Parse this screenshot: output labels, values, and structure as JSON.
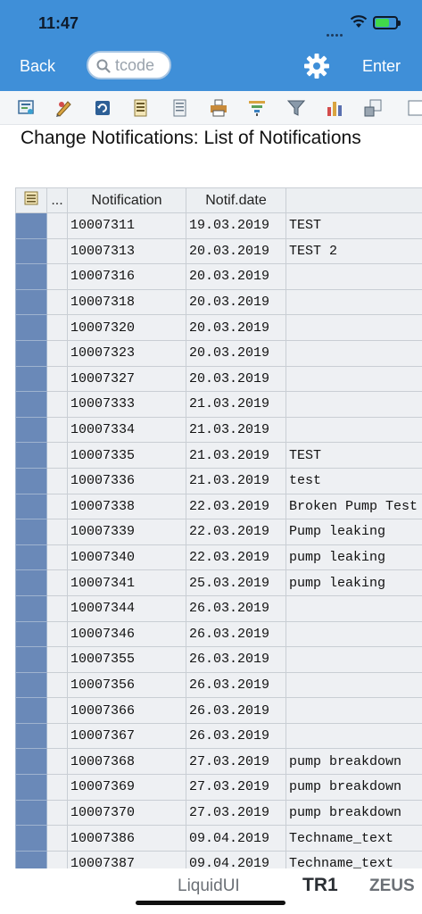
{
  "status": {
    "time": "11:47"
  },
  "nav": {
    "back_label": "Back",
    "search_placeholder": "tcode",
    "enter_label": "Enter"
  },
  "toolbar": {
    "icons": [
      "detail-icon",
      "edit-icon",
      "refresh-icon",
      "select-layout-icon",
      "change-layout-icon",
      "print-icon",
      "sort-icon",
      "filter-icon",
      "chart-icon",
      "export-icon",
      "more-icon"
    ]
  },
  "page": {
    "title": "Change Notifications: List of Notifications"
  },
  "table": {
    "headers": {
      "more": "...",
      "notification": "Notification",
      "date": "Notif.date"
    },
    "rows": [
      {
        "notification": "10007311",
        "date": "19.03.2019",
        "desc": "TEST"
      },
      {
        "notification": "10007313",
        "date": "20.03.2019",
        "desc": "TEST 2"
      },
      {
        "notification": "10007316",
        "date": "20.03.2019",
        "desc": ""
      },
      {
        "notification": "10007318",
        "date": "20.03.2019",
        "desc": ""
      },
      {
        "notification": "10007320",
        "date": "20.03.2019",
        "desc": ""
      },
      {
        "notification": "10007323",
        "date": "20.03.2019",
        "desc": ""
      },
      {
        "notification": "10007327",
        "date": "20.03.2019",
        "desc": ""
      },
      {
        "notification": "10007333",
        "date": "21.03.2019",
        "desc": ""
      },
      {
        "notification": "10007334",
        "date": "21.03.2019",
        "desc": ""
      },
      {
        "notification": "10007335",
        "date": "21.03.2019",
        "desc": "TEST"
      },
      {
        "notification": "10007336",
        "date": "21.03.2019",
        "desc": "test"
      },
      {
        "notification": "10007338",
        "date": "22.03.2019",
        "desc": "Broken Pump Test"
      },
      {
        "notification": "10007339",
        "date": "22.03.2019",
        "desc": "Pump leaking"
      },
      {
        "notification": "10007340",
        "date": "22.03.2019",
        "desc": "pump leaking"
      },
      {
        "notification": "10007341",
        "date": "25.03.2019",
        "desc": "pump leaking"
      },
      {
        "notification": "10007344",
        "date": "26.03.2019",
        "desc": ""
      },
      {
        "notification": "10007346",
        "date": "26.03.2019",
        "desc": ""
      },
      {
        "notification": "10007355",
        "date": "26.03.2019",
        "desc": ""
      },
      {
        "notification": "10007356",
        "date": "26.03.2019",
        "desc": ""
      },
      {
        "notification": "10007366",
        "date": "26.03.2019",
        "desc": ""
      },
      {
        "notification": "10007367",
        "date": "26.03.2019",
        "desc": ""
      },
      {
        "notification": "10007368",
        "date": "27.03.2019",
        "desc": "pump breakdown"
      },
      {
        "notification": "10007369",
        "date": "27.03.2019",
        "desc": "pump breakdown"
      },
      {
        "notification": "10007370",
        "date": "27.03.2019",
        "desc": "pump breakdown"
      },
      {
        "notification": "10007386",
        "date": "09.04.2019",
        "desc": "Techname_text"
      },
      {
        "notification": "10007387",
        "date": "09.04.2019",
        "desc": "Techname_text"
      }
    ]
  },
  "bottom": {
    "tab1": "LiquidUI",
    "tab2": "TR1",
    "tab3": "ZEUS"
  },
  "colors": {
    "accent": "#3f8fd8",
    "row_selector": "#6a89b8"
  }
}
